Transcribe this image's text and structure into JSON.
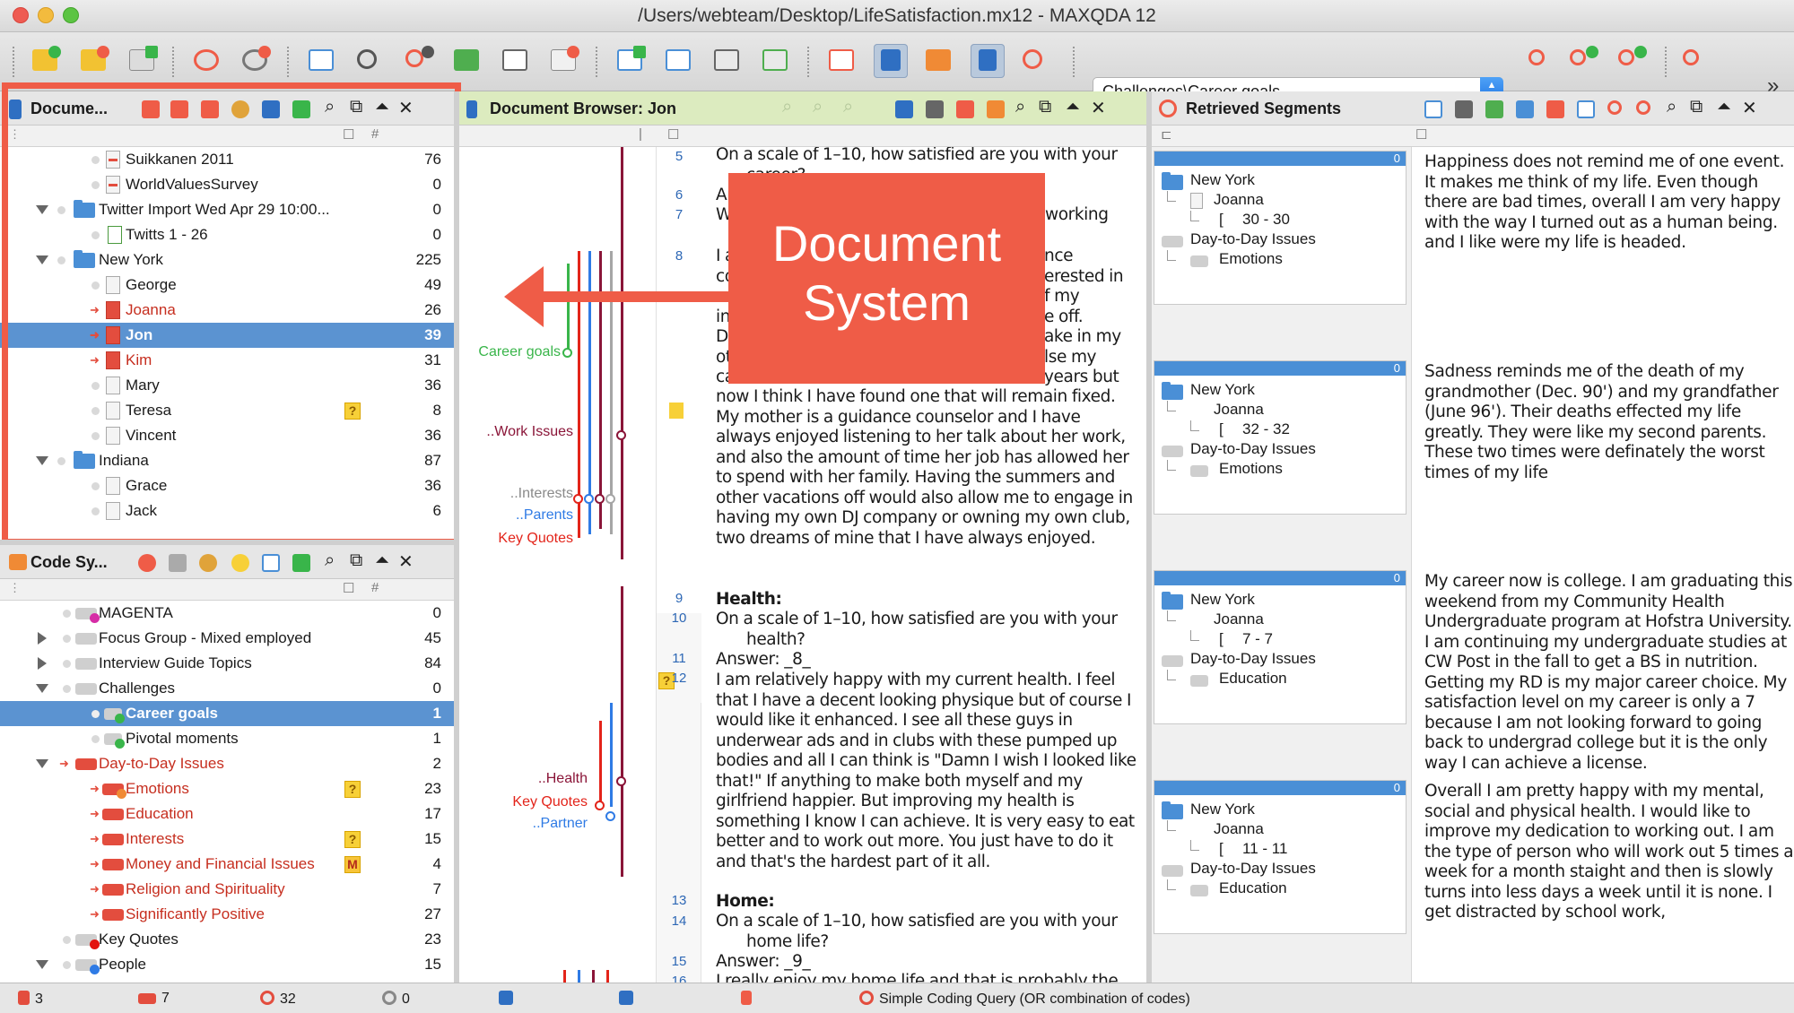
{
  "window": {
    "title": "/Users/webteam/Desktop/LifeSatisfaction.mx12 - MAXQDA 12"
  },
  "toolbar": {
    "code_select_value": "Challenges\\Career goals",
    "more": "»"
  },
  "document_system": {
    "title": "Docume...",
    "rows": [
      {
        "label": "Suikkanen 2011",
        "count": "76"
      },
      {
        "label": "WorldValuesSurvey",
        "count": "0"
      },
      {
        "label": "Twitter Import Wed Apr 29 10:00...",
        "count": "0"
      },
      {
        "label": "Twitts 1 - 26",
        "count": "0"
      },
      {
        "label": "New York",
        "count": "225"
      },
      {
        "label": "George",
        "count": "49"
      },
      {
        "label": "Joanna",
        "count": "26"
      },
      {
        "label": "Jon",
        "count": "39"
      },
      {
        "label": "Kim",
        "count": "31"
      },
      {
        "label": "Mary",
        "count": "36"
      },
      {
        "label": "Teresa",
        "count": "8"
      },
      {
        "label": "Vincent",
        "count": "36"
      },
      {
        "label": "Indiana",
        "count": "87"
      },
      {
        "label": "Grace",
        "count": "36"
      },
      {
        "label": "Jack",
        "count": "6"
      }
    ]
  },
  "code_system": {
    "title": "Code Sy...",
    "rows": [
      {
        "label": "MAGENTA",
        "count": "0"
      },
      {
        "label": "Focus Group - Mixed employed",
        "count": "45"
      },
      {
        "label": "Interview Guide Topics",
        "count": "84"
      },
      {
        "label": "Challenges",
        "count": "0"
      },
      {
        "label": "Career goals",
        "count": "1"
      },
      {
        "label": "Pivotal moments",
        "count": "1"
      },
      {
        "label": "Day-to-Day Issues",
        "count": "2"
      },
      {
        "label": "Emotions",
        "count": "23"
      },
      {
        "label": "Education",
        "count": "17"
      },
      {
        "label": "Interests",
        "count": "15"
      },
      {
        "label": "Money and Financial Issues",
        "count": "4"
      },
      {
        "label": "Religion and Spirituality",
        "count": "7"
      },
      {
        "label": "Significantly Positive",
        "count": "27"
      },
      {
        "label": "Key Quotes",
        "count": "23"
      },
      {
        "label": "People",
        "count": "15"
      }
    ]
  },
  "browser": {
    "title": "Document Browser: Jon",
    "margin_labels": [
      "Career goals",
      "..Work Issues",
      "..Interests",
      "..Parents",
      "Key Quotes",
      "..Health",
      "Key Quotes",
      "..Partner"
    ],
    "para_numbers": [
      "5",
      "6",
      "7",
      "8",
      "9",
      "10",
      "11",
      "12",
      "13",
      "14",
      "15",
      "16"
    ],
    "paragraphs": {
      "p5": "On a scale of 1–10, how satisfied are you with your",
      "p5b": "career?",
      "p6": "An",
      "p7": "Wh",
      "p7r": "working",
      "p8a": "I a",
      "p8a_r": "nce",
      "p8b": "co",
      "p8b_r": "erested in",
      "p8c": "wo",
      "p8c_r": "f my",
      "p8d": "int",
      "p8d_r": "e off.",
      "p8e": "Du",
      "p8e_r": "ake in my",
      "p8f": "oth",
      "p8f_r": "lse my",
      "p8g": "ca",
      "p8g_r": "years but",
      "p8rest": "now I think I have found one that will remain fixed. My mother is a guidance counselor and I have always enjoyed listening to her talk about her work, and also the amount of time her job has allowed her to spend with her family.  Having the summers and other vacations off would also allow me to engage in having my own DJ company or owning my own club, two dreams of mine that I have always enjoyed.",
      "p9": "Health:",
      "p10a": "On a scale of 1–10, how satisfied are you with your",
      "p10b": "health?",
      "p11": "Answer:  _8_",
      "p12": "I am relatively happy with my current health.  I feel that I have a decent looking physique but of course I would like it enhanced.  I see all these guys in underwear ads and in clubs with these pumped up bodies and all I can think is \"Damn I wish I looked like that!\"  If anything to make both myself and my girlfriend happier.  But improving my health is something I know I can achieve.  It is very easy to eat better and to work out more.  You just have to do it and that's the hardest part of it all.",
      "p13": "Home:",
      "p14a": "On a scale of 1–10, how satisfied are you with your",
      "p14b": "home life?",
      "p15": "Answer:  _9_",
      "p16": "I really enjoy my home life and that is probably the"
    }
  },
  "callout": {
    "line1": "Document",
    "line2": "System"
  },
  "retrieved": {
    "title": "Retrieved Segments",
    "segments": [
      {
        "count": "0",
        "group": "New York",
        "doc": "Joanna",
        "range": "30 - 30",
        "code_parent": "Day-to-Day Issues",
        "code": "Emotions",
        "text": "Happiness does not remind me of one event. It makes me think of my life.  Even though there are bad times, overall I am very happy with the way I turned out as a human being. and I like were my life is headed."
      },
      {
        "count": "0",
        "group": "New York",
        "doc": "Joanna",
        "range": "32 - 32",
        "code_parent": "Day-to-Day Issues",
        "code": "Emotions",
        "text": "Sadness reminds me of the death of my grandmother (Dec. 90') and my grandfather (June 96').  Their deaths effected my life greatly. They were like my second parents. These two times were definately the worst times of my life"
      },
      {
        "count": "0",
        "group": "New York",
        "doc": "Joanna",
        "range": "7 - 7",
        "code_parent": "Day-to-Day Issues",
        "code": "Education",
        "text": "My career now is college. I am graduating this weekend from my Community Health Undergraduate program at Hofstra University.  I am continuing my undergraduate studies at CW Post in the fall to get a BS in nutrition.  Getting my RD is my major career choice.  My satisfaction level on my career is only a 7 because I am not looking forward to going back to undergrad college but it is the only way I can achieve a license."
      },
      {
        "count": "0",
        "group": "New York",
        "doc": "Joanna",
        "range": "11 - 11",
        "code_parent": "Day-to-Day Issues",
        "code": "Education",
        "text": "Overall I am pretty happy with my mental, social and physical health.  I would like to improve my dedication to working out.  I am the type of person who will work out 5 times a week for a month staight and then is slowly turns into less days a week until it is none.  I get distracted by school work,"
      }
    ]
  },
  "statusbar": {
    "docs": "3",
    "codes": "7",
    "segments": "32",
    "activated": "0",
    "query": "Simple Coding Query (OR combination of codes)"
  },
  "colors": {
    "accent_red": "#ef5c47",
    "selection_blue": "#5b93d1",
    "browser_header": "#dcebbf"
  }
}
